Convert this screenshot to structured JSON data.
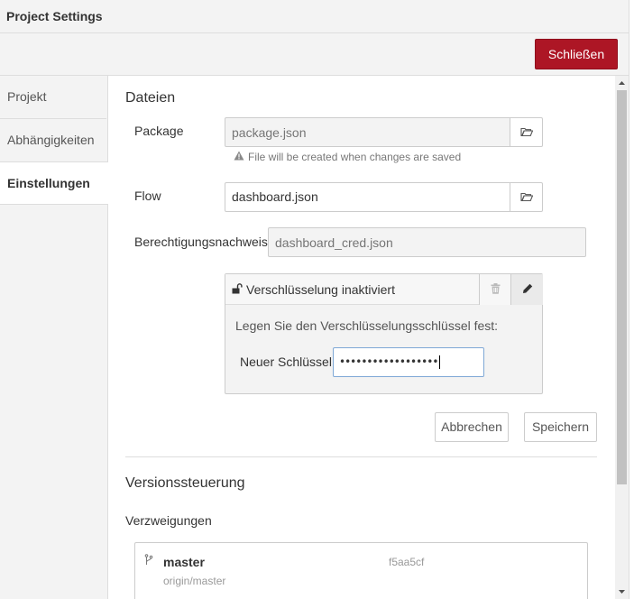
{
  "window": {
    "title": "Project Settings"
  },
  "toolbar": {
    "close_label": "Schließen"
  },
  "sidebar": {
    "items": [
      {
        "label": "Projekt",
        "active": false
      },
      {
        "label": "Abhängigkeiten",
        "active": false
      },
      {
        "label": "Einstellungen",
        "active": true
      }
    ]
  },
  "files": {
    "title": "Dateien",
    "package": {
      "label": "Package",
      "placeholder": "package.json",
      "hint": "File will be created when changes are saved"
    },
    "flow": {
      "label": "Flow",
      "value": "dashboard.json"
    },
    "credentials": {
      "label": "Berechtigungsnachweis",
      "placeholder": "dashboard_cred.json"
    },
    "encryption": {
      "status": "Verschlüsselung inaktiviert",
      "prompt": "Legen Sie den Verschlüsselungsschlüssel fest:",
      "key_label": "Neuer Schlüssel",
      "key_value": "••••••••••••••••••"
    },
    "cancel_label": "Abbrechen",
    "save_label": "Speichern"
  },
  "version_control": {
    "title": "Versionssteuerung",
    "branches_title": "Verzweigungen",
    "branch": {
      "name": "master",
      "hash": "f5aa5cf",
      "remote": "origin/master"
    }
  },
  "colors": {
    "accent": "#ad1625",
    "border": "#cccccc",
    "panel": "#f3f3f3"
  }
}
